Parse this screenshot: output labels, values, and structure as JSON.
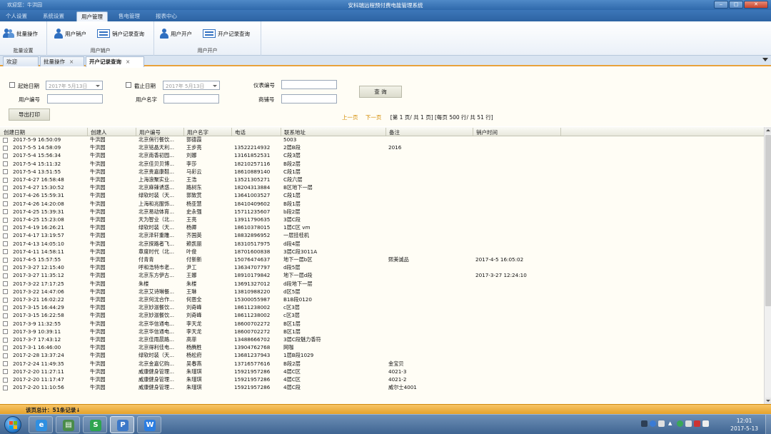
{
  "window": {
    "title": "安科瑞远程预付费电能管理系统",
    "welcome": "欢迎您：牛洪园",
    "controls": [
      "‒",
      "□",
      "✕"
    ]
  },
  "menu": {
    "tabs": [
      {
        "label": "个人设置",
        "active": false
      },
      {
        "label": "系统设置",
        "active": false
      },
      {
        "label": "用户管理",
        "active": true
      },
      {
        "label": "售电管理",
        "active": false
      },
      {
        "label": "报表中心",
        "active": false
      }
    ]
  },
  "ribbon": {
    "batch": {
      "button": "批量操作",
      "group": "批量设置"
    },
    "cancel": {
      "button1": "用户销户",
      "button2": "销户记录查询",
      "group": "用户销户"
    },
    "open": {
      "button1": "用户开户",
      "button2": "开户记录查询",
      "group": "用户开户"
    }
  },
  "doc_tabs": [
    {
      "label": "欢迎",
      "active": false,
      "closable": false
    },
    {
      "label": "批量操作",
      "active": false,
      "closable": true
    },
    {
      "label": "开户记录查询",
      "active": true,
      "closable": true
    }
  ],
  "form": {
    "start_date_label": "起始日期",
    "start_date_value": "2017年  5月13日",
    "end_date_label": "截止日期",
    "end_date_value": "2017年  5月13日",
    "meter_no_label": "仪表编号",
    "meter_no_value": "",
    "user_no_label": "用户编号",
    "user_no_value": "",
    "user_name_label": "用户名字",
    "user_name_value": "",
    "shop_no_label": "商铺号",
    "shop_no_value": "",
    "query_button": "查 询",
    "export_button": "导出打印"
  },
  "pager": {
    "prev": "上一页",
    "next": "下一页",
    "info": "[第    1 页/ 共    1 页]  [每页  500 行/ 共     51 行]"
  },
  "grid": {
    "columns": [
      "创建日期",
      "创建人",
      "用户编号",
      "用户名字",
      "电话",
      "联系地址",
      "备注",
      "销户时间"
    ],
    "rows": [
      [
        "2017-5-9 16:50:09",
        "牛洪园",
        "北京俏行餐饮...",
        "郭德霞",
        "",
        "5003",
        "",
        ""
      ],
      [
        "2017-5-5 14:58:09",
        "牛洪园",
        "北京铭晶天利...",
        "王步亮",
        "13522214932",
        "2层B段",
        "2016",
        ""
      ],
      [
        "2017-5-4 15:56:34",
        "牛洪园",
        "北京南香初园...",
        "刘娜",
        "13161852531",
        "C段3层",
        "",
        ""
      ],
      [
        "2017-5-4 15:11:32",
        "牛洪园",
        "北京佳贝贝博...",
        "李莎",
        "18210257116",
        "B段2层",
        "",
        ""
      ],
      [
        "2017-5-4 13:51:55",
        "牛洪园",
        "北京贵嘉康鞋...",
        "马彩云",
        "18610889140",
        "C段1层",
        "",
        ""
      ],
      [
        "2017-4-27 16:58:48",
        "牛洪园",
        "上海浪聚实业...",
        "王浩",
        "13521305271",
        "C段六层",
        "",
        ""
      ],
      [
        "2017-4-27 15:30:52",
        "牛洪园",
        "北京麻辣诱惑...",
        "路树东",
        "18204313884",
        "B区地下一层",
        "",
        ""
      ],
      [
        "2017-4-26 15:59:31",
        "牛洪园",
        "绿软时装（天...",
        "郭致赏",
        "13641003527",
        "C段1层",
        "",
        ""
      ],
      [
        "2017-4-26 14:20:08",
        "牛洪园",
        "上海和兆服饰...",
        "杨亚慧",
        "18410409602",
        "B段1层",
        "",
        ""
      ],
      [
        "2017-4-25 15:39:31",
        "牛洪园",
        "北京易动体育...",
        "史永强",
        "15711235607",
        "b段2层",
        "",
        ""
      ],
      [
        "2017-4-25 15:23:08",
        "牛洪园",
        "天为智业（北...",
        "王亮",
        "13911790635",
        "3层C段",
        "",
        ""
      ],
      [
        "2017-4-19 16:26:21",
        "牛洪园",
        "绿软时装（天...",
        "杨卿",
        "18610378015",
        "1层C区 vm",
        "",
        ""
      ],
      [
        "2017-4-17 13:19:57",
        "牛洪园",
        "北京泽轩重雕...",
        "齐国英",
        "18832896952",
        "一层挂桂机",
        "",
        ""
      ],
      [
        "2017-4-13 14:05:10",
        "牛洪园",
        "北京探路者飞...",
        "赖凯丽",
        "18310517975",
        "d段4层",
        "",
        ""
      ],
      [
        "2017-4-11 14:58:11",
        "牛洪园",
        "章度时代（北...",
        "叶俊",
        "18701600838",
        "3层C段3011A",
        "",
        ""
      ],
      [
        "2017-4-5 15:57:55",
        "牛洪园",
        "付青青",
        "付新新",
        "15076474637",
        "地下一层b区",
        "熙美诚品",
        "2017-4-5 16:05:02"
      ],
      [
        "2017-3-27 12:15:40",
        "牛洪园",
        "呼和浩特市老...",
        "尹工",
        "13634707797",
        "d段5层",
        "",
        ""
      ],
      [
        "2017-3-27 11:35:12",
        "牛洪园",
        "北京东方伊古...",
        "王娜",
        "18910179842",
        "地下一层d段",
        "",
        "2017-3-27 12:24:10"
      ],
      [
        "2017-3-22 17:17:25",
        "牛洪园",
        "朱楼",
        "朱楼",
        "13691327012",
        "d段地下一层",
        "",
        ""
      ],
      [
        "2017-3-22 14:47:06",
        "牛洪园",
        "北京艾诗琳餐...",
        "王琳",
        "13810988220",
        "d区5层",
        "",
        ""
      ],
      [
        "2017-3-21 16:02:22",
        "牛洪园",
        "北京何沈合作...",
        "何恩全",
        "15300055987",
        "B1B段0120",
        "",
        ""
      ],
      [
        "2017-3-15 16:44:29",
        "牛洪园",
        "北京妙滋餐饮...",
        "刘奇峰",
        "18611238002",
        "c区3层",
        "",
        ""
      ],
      [
        "2017-3-15 16:22:58",
        "牛洪园",
        "北京妙滋餐饮...",
        "刘奇峰",
        "18611238002",
        "c区3层",
        "",
        ""
      ],
      [
        "2017-3-9 11:32:55",
        "牛洪园",
        "北京华信通电...",
        "李天龙",
        "18600702272",
        "B区1层",
        "",
        ""
      ],
      [
        "2017-3-9 10:39:11",
        "牛洪园",
        "北京华信通电...",
        "李天龙",
        "18600702272",
        "B区1层",
        "",
        ""
      ],
      [
        "2017-3-7 17:43:12",
        "牛洪园",
        "北京佳雨晨路...",
        "高菲",
        "13488666702",
        "3层C段魅力香符",
        "",
        ""
      ],
      [
        "2017-3-1 16:46:00",
        "牛洪园",
        "北京得利佳电...",
        "杨腾胜",
        "13904762768",
        "网咖",
        "",
        ""
      ],
      [
        "2017-2-28 13:37:24",
        "牛洪园",
        "绿软时装（天...",
        "杨松府",
        "13681237943",
        "1层B段1029",
        "",
        ""
      ],
      [
        "2017-2-24 11:49:35",
        "牛洪园",
        "北京金嘉亿购...",
        "吴春燕",
        "13716577616",
        "B段2层",
        "金宝贝",
        ""
      ],
      [
        "2017-2-20 11:27:11",
        "牛洪园",
        "威康健身管理...",
        "朱瑾琪",
        "15921957286",
        "4层C区",
        "4021-3",
        ""
      ],
      [
        "2017-2-20 11:17:47",
        "牛洪园",
        "威康健身管理...",
        "朱瑾琪",
        "15921957286",
        "4层C区",
        "4021-2",
        ""
      ],
      [
        "2017-2-20 11:10:56",
        "牛洪园",
        "威康健身管理...",
        "朱瑾琪",
        "15921957286",
        "4层C段",
        "威尔士4001",
        ""
      ]
    ]
  },
  "status": {
    "text": "该页总计：51条记录↓"
  },
  "taskbar": {
    "apps": [
      {
        "icon": "ie-icon",
        "glyph": "e",
        "color": "#2f8fe0",
        "active": false
      },
      {
        "icon": "explorer-icon",
        "glyph": "▤",
        "color": "#4a8c4a",
        "active": false
      },
      {
        "icon": "spreadsheet-icon",
        "glyph": "S",
        "color": "#2ea44f",
        "active": false
      },
      {
        "icon": "app-icon",
        "glyph": "P",
        "color": "#3c78c8",
        "active": true
      },
      {
        "icon": "writer-icon",
        "glyph": "W",
        "color": "#2b7de0",
        "active": false
      }
    ],
    "time": "12:01",
    "date": "2017-5-13"
  }
}
